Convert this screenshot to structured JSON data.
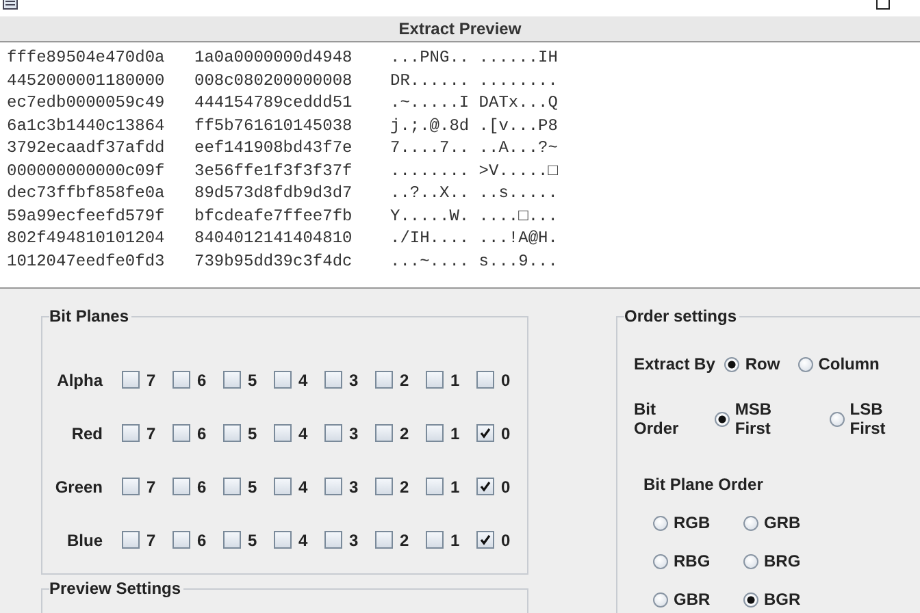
{
  "preview": {
    "title": "Extract Preview",
    "rows": [
      {
        "hex_1": "fffe89504e470d0a",
        "hex_2": "1a0a0000000d4948",
        "ascii": "...PNG.. ......IH"
      },
      {
        "hex_1": "4452000001180000",
        "hex_2": "008c080200000008",
        "ascii": "DR...... ........"
      },
      {
        "hex_1": "ec7edb0000059c49",
        "hex_2": "444154789ceddd51",
        "ascii": ".~.....I DATx...Q"
      },
      {
        "hex_1": "6a1c3b1440c13864",
        "hex_2": "ff5b761610145038",
        "ascii": "j.;.@.8d .[v...P8"
      },
      {
        "hex_1": "3792ecaadf37afdd",
        "hex_2": "eef141908bd43f7e",
        "ascii": "7....7.. ..A...?~"
      },
      {
        "hex_1": "000000000000c09f",
        "hex_2": "3e56ffe1f3f3f37f",
        "ascii": "........ >V.....□"
      },
      {
        "hex_1": "dec73ffbf858fe0a",
        "hex_2": "89d573d8fdb9d3d7",
        "ascii": "..?..X.. ..s....."
      },
      {
        "hex_1": "59a99ecfeefd579f",
        "hex_2": "bfcdeafe7ffee7fb",
        "ascii": "Y.....W. ....□..."
      },
      {
        "hex_1": "802f494810101204",
        "hex_2": "8404012141404810",
        "ascii": "./IH.... ...!A@H."
      },
      {
        "hex_1": "1012047eedfe0fd3",
        "hex_2": "739b95dd39c3f4dc",
        "ascii": "...~.... s...9..."
      }
    ]
  },
  "bit_planes": {
    "title": "Bit Planes",
    "channels": [
      {
        "name": "Alpha",
        "bits": [
          {
            "label": "7",
            "checked": false
          },
          {
            "label": "6",
            "checked": false
          },
          {
            "label": "5",
            "checked": false
          },
          {
            "label": "4",
            "checked": false
          },
          {
            "label": "3",
            "checked": false
          },
          {
            "label": "2",
            "checked": false
          },
          {
            "label": "1",
            "checked": false
          },
          {
            "label": "0",
            "checked": false
          }
        ]
      },
      {
        "name": "Red",
        "bits": [
          {
            "label": "7",
            "checked": false
          },
          {
            "label": "6",
            "checked": false
          },
          {
            "label": "5",
            "checked": false
          },
          {
            "label": "4",
            "checked": false
          },
          {
            "label": "3",
            "checked": false
          },
          {
            "label": "2",
            "checked": false
          },
          {
            "label": "1",
            "checked": false
          },
          {
            "label": "0",
            "checked": true
          }
        ]
      },
      {
        "name": "Green",
        "bits": [
          {
            "label": "7",
            "checked": false
          },
          {
            "label": "6",
            "checked": false
          },
          {
            "label": "5",
            "checked": false
          },
          {
            "label": "4",
            "checked": false
          },
          {
            "label": "3",
            "checked": false
          },
          {
            "label": "2",
            "checked": false
          },
          {
            "label": "1",
            "checked": false
          },
          {
            "label": "0",
            "checked": true
          }
        ]
      },
      {
        "name": "Blue",
        "bits": [
          {
            "label": "7",
            "checked": false
          },
          {
            "label": "6",
            "checked": false
          },
          {
            "label": "5",
            "checked": false
          },
          {
            "label": "4",
            "checked": false
          },
          {
            "label": "3",
            "checked": false
          },
          {
            "label": "2",
            "checked": false
          },
          {
            "label": "1",
            "checked": false
          },
          {
            "label": "0",
            "checked": true
          }
        ]
      }
    ]
  },
  "preview_settings": {
    "title": "Preview Settings"
  },
  "order_settings": {
    "title": "Order settings",
    "extract_by": {
      "label": "Extract By",
      "options": [
        {
          "label": "Row",
          "selected": true
        },
        {
          "label": "Column",
          "selected": false
        }
      ]
    },
    "bit_order": {
      "label": "Bit Order",
      "options": [
        {
          "label": "MSB First",
          "selected": true
        },
        {
          "label": "LSB First",
          "selected": false
        }
      ]
    },
    "bit_plane_order": {
      "label": "Bit Plane Order",
      "options": [
        {
          "label": "RGB",
          "selected": false
        },
        {
          "label": "GRB",
          "selected": false
        },
        {
          "label": "RBG",
          "selected": false
        },
        {
          "label": "BRG",
          "selected": false
        },
        {
          "label": "GBR",
          "selected": false
        },
        {
          "label": "BGR",
          "selected": true
        }
      ]
    }
  }
}
